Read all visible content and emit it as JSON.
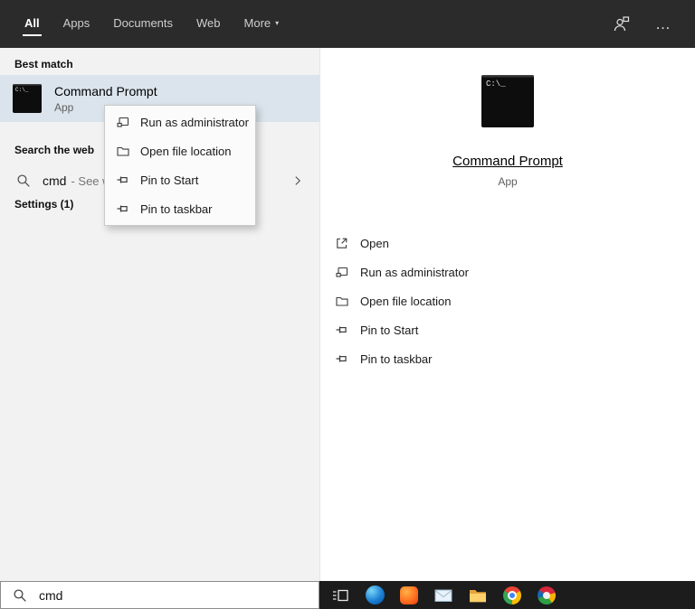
{
  "header": {
    "tabs": [
      {
        "label": "All"
      },
      {
        "label": "Apps"
      },
      {
        "label": "Documents"
      },
      {
        "label": "Web"
      },
      {
        "label": "More"
      }
    ],
    "selected_tab": "All",
    "more_arrow": "▾",
    "ellipsis": "…"
  },
  "left_panel": {
    "sections": {
      "best_match": "Best match",
      "search_the_web": "Search the web",
      "settings": "Settings (1)"
    },
    "best_match_item": {
      "title": "Command Prompt",
      "subtitle": "App"
    },
    "web_item": {
      "query": "cmd",
      "suffix": "- See w"
    }
  },
  "context_menu": {
    "items": [
      {
        "label": "Run as administrator",
        "icon": "run-as-admin-icon"
      },
      {
        "label": "Open file location",
        "icon": "file-location-icon"
      },
      {
        "label": "Pin to Start",
        "icon": "pin-icon"
      },
      {
        "label": "Pin to taskbar",
        "icon": "pin-icon"
      }
    ]
  },
  "preview_panel": {
    "title": "Command Prompt",
    "subtitle": "App",
    "actions": [
      {
        "label": "Open",
        "icon": "open-icon"
      },
      {
        "label": "Run as administrator",
        "icon": "run-as-admin-icon"
      },
      {
        "label": "Open file location",
        "icon": "file-location-icon"
      },
      {
        "label": "Pin to Start",
        "icon": "pin-icon"
      },
      {
        "label": "Pin to taskbar",
        "icon": "pin-icon"
      }
    ]
  },
  "search_bar": {
    "value": "cmd"
  },
  "taskbar": {
    "icons": [
      "task-view-icon",
      "edge-icon",
      "orange-app-icon",
      "mail-icon",
      "file-explorer-icon",
      "chrome-icon",
      "colorful-app-icon"
    ]
  },
  "icons": {
    "search": "magnifier glyph",
    "chevron_right": "›",
    "pin": "sideways pushpin",
    "cmd": "black terminal window",
    "user": "person silhouette",
    "ellipsis": "…"
  },
  "colors": {
    "header_bg": "#2b2b2b",
    "left_panel_bg": "#f2f2f2",
    "best_match_highlight": "#dbe4ec",
    "taskbar_bg": "#1c1c1c",
    "accent": "#0078d7"
  }
}
